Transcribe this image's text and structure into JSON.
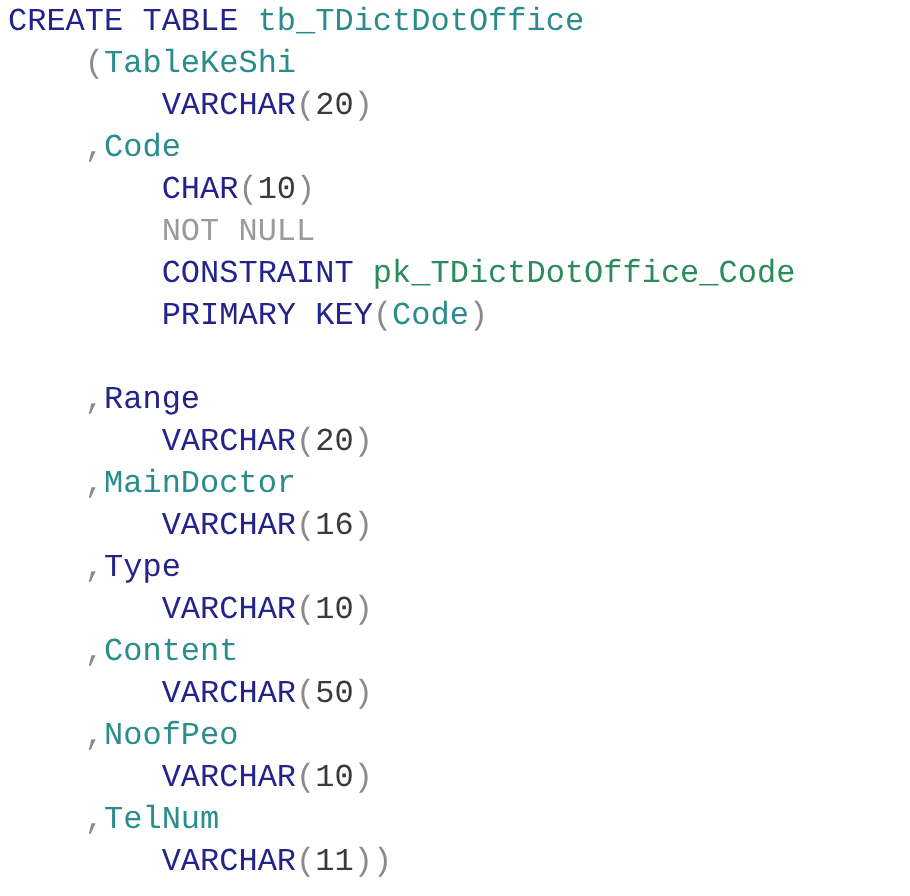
{
  "editor": {
    "lines": [
      {
        "kind": "code",
        "tokens": [
          {
            "text": "CREATE TABLE",
            "kind": "keyword"
          },
          {
            "text": " tb_TDictDotOffice",
            "kind": "identifier"
          }
        ],
        "children": [
          {
            "kind": "code",
            "tokens": [
              {
                "text": "(",
                "kind": "punct"
              },
              {
                "text": "TableKeShi",
                "kind": "identifier"
              }
            ],
            "children": [
              {
                "kind": "code",
                "tokens": [
                  {
                    "text": "VARCHAR",
                    "kind": "keyword"
                  },
                  {
                    "text": "(",
                    "kind": "punct"
                  },
                  {
                    "text": "20",
                    "kind": "number"
                  },
                  {
                    "text": ")",
                    "kind": "punct"
                  }
                ]
              }
            ]
          },
          {
            "kind": "code",
            "tokens": [
              {
                "text": ",",
                "kind": "punct"
              },
              {
                "text": "Code",
                "kind": "identifier"
              }
            ],
            "children": [
              {
                "kind": "code",
                "tokens": [
                  {
                    "text": "CHAR",
                    "kind": "keyword"
                  },
                  {
                    "text": "(",
                    "kind": "punct"
                  },
                  {
                    "text": "10",
                    "kind": "number"
                  },
                  {
                    "text": ")",
                    "kind": "punct"
                  }
                ]
              },
              {
                "kind": "code",
                "tokens": [
                  {
                    "text": "NOT NULL",
                    "kind": "null"
                  }
                ]
              },
              {
                "kind": "code",
                "tokens": [
                  {
                    "text": "CONSTRAINT",
                    "kind": "keyword"
                  },
                  {
                    "text": " pk_TDictDotOffice_Code",
                    "kind": "name"
                  }
                ]
              },
              {
                "kind": "code",
                "tokens": [
                  {
                    "text": "PRIMARY KEY",
                    "kind": "keyword"
                  },
                  {
                    "text": "(",
                    "kind": "punct"
                  },
                  {
                    "text": "Code",
                    "kind": "identifier"
                  },
                  {
                    "text": ")",
                    "kind": "punct"
                  }
                ]
              },
              {
                "kind": "blank"
              }
            ]
          },
          {
            "kind": "code",
            "tokens": [
              {
                "text": ",",
                "kind": "punct"
              },
              {
                "text": "Range",
                "kind": "keyword"
              }
            ],
            "children": [
              {
                "kind": "code",
                "tokens": [
                  {
                    "text": "VARCHAR",
                    "kind": "keyword"
                  },
                  {
                    "text": "(",
                    "kind": "punct"
                  },
                  {
                    "text": "20",
                    "kind": "number"
                  },
                  {
                    "text": ")",
                    "kind": "punct"
                  }
                ]
              }
            ]
          },
          {
            "kind": "code",
            "tokens": [
              {
                "text": ",",
                "kind": "punct"
              },
              {
                "text": "MainDoctor",
                "kind": "identifier"
              }
            ],
            "children": [
              {
                "kind": "code",
                "tokens": [
                  {
                    "text": "VARCHAR",
                    "kind": "keyword"
                  },
                  {
                    "text": "(",
                    "kind": "punct"
                  },
                  {
                    "text": "16",
                    "kind": "number"
                  },
                  {
                    "text": ")",
                    "kind": "punct"
                  }
                ]
              }
            ]
          },
          {
            "kind": "code",
            "tokens": [
              {
                "text": ",",
                "kind": "punct"
              },
              {
                "text": "Type",
                "kind": "keyword"
              }
            ],
            "children": [
              {
                "kind": "code",
                "tokens": [
                  {
                    "text": "VARCHAR",
                    "kind": "keyword"
                  },
                  {
                    "text": "(",
                    "kind": "punct"
                  },
                  {
                    "text": "10",
                    "kind": "number"
                  },
                  {
                    "text": ")",
                    "kind": "punct"
                  }
                ]
              }
            ]
          },
          {
            "kind": "code",
            "tokens": [
              {
                "text": ",",
                "kind": "punct"
              },
              {
                "text": "Content",
                "kind": "identifier"
              }
            ],
            "children": [
              {
                "kind": "code",
                "tokens": [
                  {
                    "text": "VARCHAR",
                    "kind": "keyword"
                  },
                  {
                    "text": "(",
                    "kind": "punct"
                  },
                  {
                    "text": "50",
                    "kind": "number"
                  },
                  {
                    "text": ")",
                    "kind": "punct"
                  }
                ]
              }
            ]
          },
          {
            "kind": "code",
            "tokens": [
              {
                "text": ",",
                "kind": "punct"
              },
              {
                "text": "NoofPeo",
                "kind": "identifier"
              }
            ],
            "children": [
              {
                "kind": "code",
                "tokens": [
                  {
                    "text": "VARCHAR",
                    "kind": "keyword"
                  },
                  {
                    "text": "(",
                    "kind": "punct"
                  },
                  {
                    "text": "10",
                    "kind": "number"
                  },
                  {
                    "text": ")",
                    "kind": "punct"
                  }
                ]
              }
            ]
          },
          {
            "kind": "code",
            "tokens": [
              {
                "text": ",",
                "kind": "punct"
              },
              {
                "text": "TelNum",
                "kind": "identifier"
              }
            ],
            "children": [
              {
                "kind": "code",
                "tokens": [
                  {
                    "text": "VARCHAR",
                    "kind": "keyword"
                  },
                  {
                    "text": "(",
                    "kind": "punct"
                  },
                  {
                    "text": "11",
                    "kind": "number"
                  },
                  {
                    "text": "))",
                    "kind": "punct"
                  }
                ]
              }
            ]
          }
        ]
      }
    ]
  }
}
